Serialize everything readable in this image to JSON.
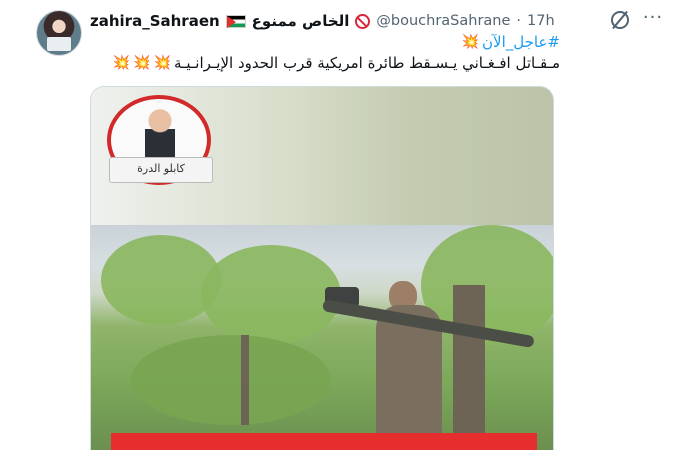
{
  "author": {
    "display_name": "zahira_Sahraen",
    "name_suffix": "الخاص ممنوع",
    "handle": "@bouchraSahrane",
    "separator": "·",
    "time": "17h"
  },
  "icons": {
    "flag": "palestine-flag-icon",
    "ban": "no-entry-icon",
    "grok": "grok-icon",
    "more": "more-options-icon",
    "burst": "collision-emoji-icon"
  },
  "tweet": {
    "hashtag": "#عاجل_الآن",
    "text": "مـقـاتل افـغـاني يـسـقط طائرة امريكية قرب الحدود الإيـرانـيـة",
    "emoji_burst": "💥"
  },
  "media": {
    "logo_caption": "كابلو الدرة"
  },
  "colors": {
    "link": "#1d9bf0",
    "text": "#0f1419",
    "muted": "#536471",
    "caption_bar": "#e62e2e"
  }
}
